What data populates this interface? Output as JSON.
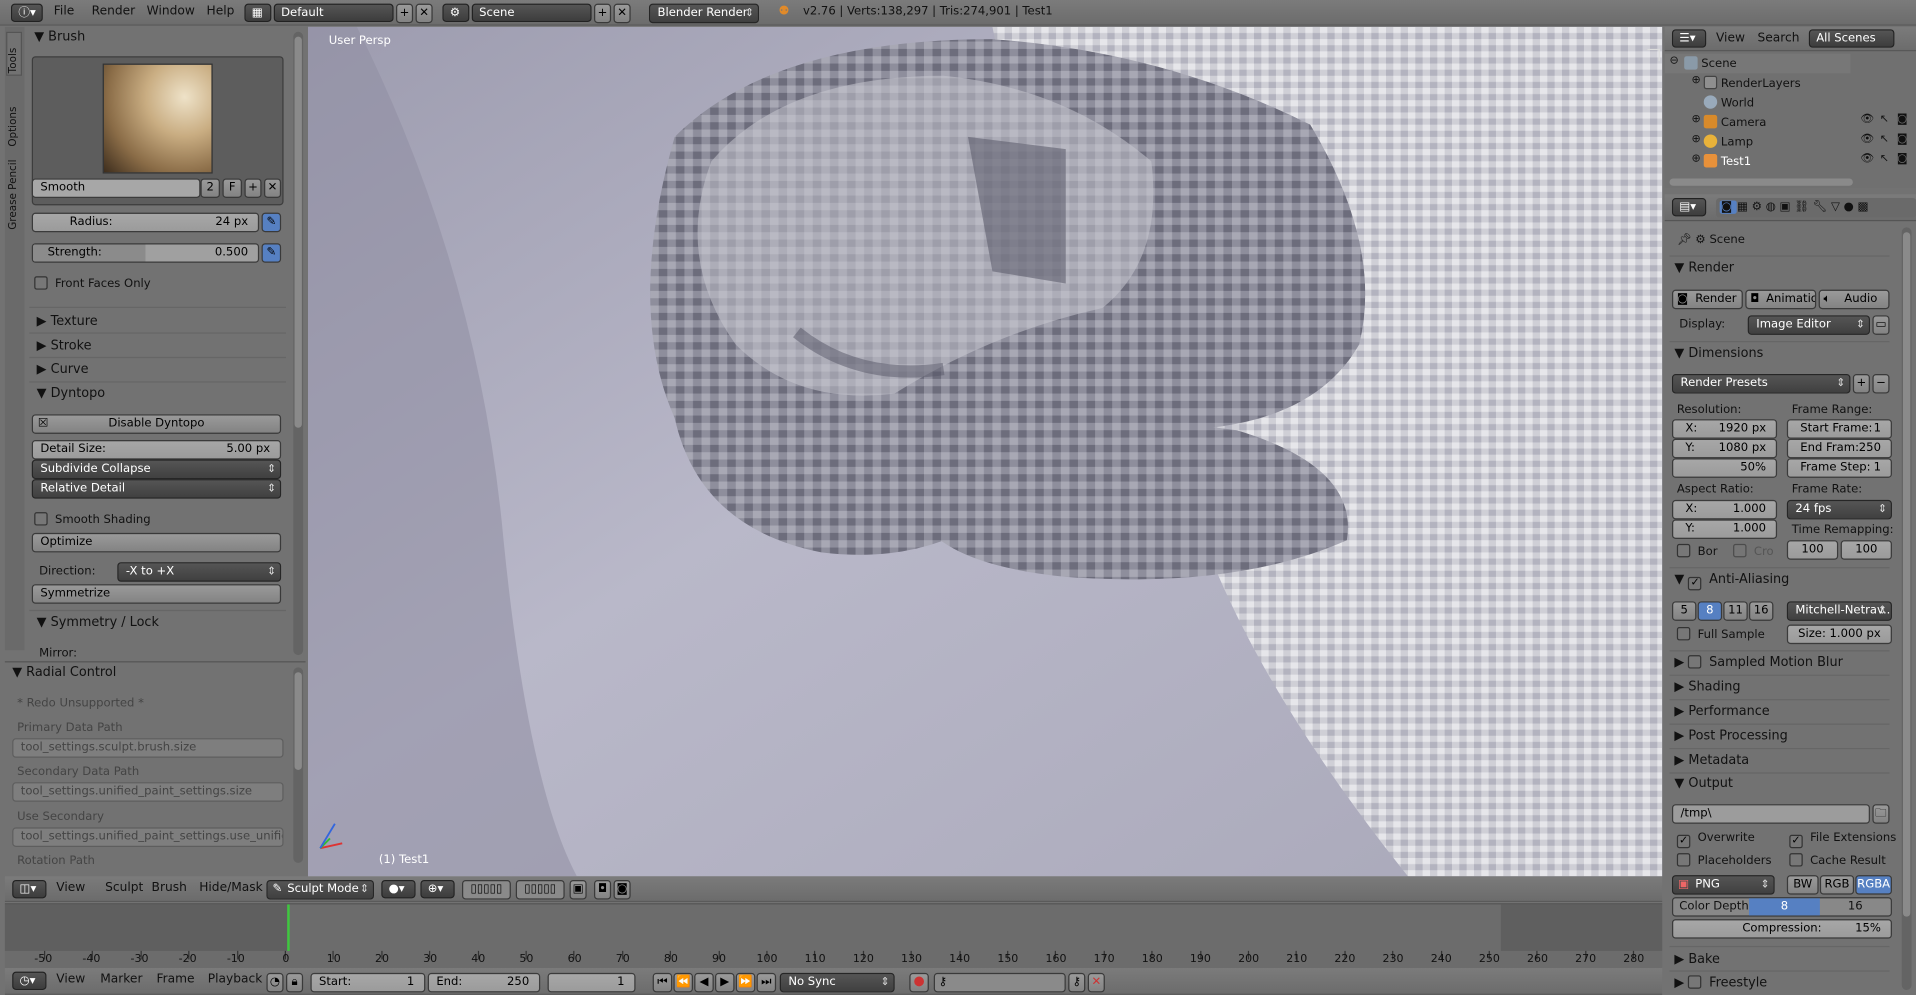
{
  "topbar": {
    "menus": [
      "File",
      "Render",
      "Window",
      "Help"
    ],
    "layout": "Default",
    "scene": "Scene",
    "engine": "Blender Render",
    "stats": "v2.76 | Verts:138,297 | Tris:274,901 | Test1"
  },
  "toolshelf": {
    "tabs": [
      "Tools",
      "Options",
      "Grease Pencil"
    ],
    "brush_header": "Brush",
    "brush_name": "Smooth",
    "brush_users": "2",
    "fake_user": "F",
    "radius_label": "Radius:",
    "radius_value": "24 px",
    "strength_label": "Strength:",
    "strength_value": "0.500",
    "strength_fill": 0.5,
    "front_faces": "Front Faces Only",
    "panels": [
      "Texture",
      "Stroke",
      "Curve"
    ],
    "dyntopo_header": "Dyntopo",
    "disable_dyntopo": "Disable Dyntopo",
    "detail_size_label": "Detail Size:",
    "detail_size_value": "5.00 px",
    "subdivide": "Subdivide Collapse",
    "relative": "Relative Detail",
    "smooth_shading": "Smooth Shading",
    "optimize": "Optimize",
    "direction_label": "Direction:",
    "direction_value": "-X to +X",
    "symmetrize": "Symmetrize",
    "symmetry_header": "Symmetry / Lock",
    "mirror_label": "Mirror:"
  },
  "redo": {
    "header": "Radial Control",
    "unsupported": "* Redo Unsupported *",
    "primary_label": "Primary Data Path",
    "primary_value": "tool_settings.sculpt.brush.size",
    "secondary_label": "Secondary Data Path",
    "secondary_value": "tool_settings.unified_paint_settings.size",
    "use_secondary_label": "Use Secondary",
    "use_secondary_value": "tool_settings.unified_paint_settings.use_unified_size",
    "rotation_label": "Rotation Path"
  },
  "viewport": {
    "view_name": "User Persp",
    "object_label": "(1) Test1"
  },
  "viewport_header": {
    "menus": [
      "View",
      "Sculpt",
      "Brush",
      "Hide/Mask"
    ],
    "mode": "Sculpt Mode"
  },
  "outliner": {
    "menus": [
      "View",
      "Search"
    ],
    "filter": "All Scenes",
    "items": [
      {
        "name": "Scene",
        "indent": 0
      },
      {
        "name": "RenderLayers",
        "indent": 1
      },
      {
        "name": "World",
        "indent": 1
      },
      {
        "name": "Camera",
        "indent": 1
      },
      {
        "name": "Lamp",
        "indent": 1
      },
      {
        "name": "Test1",
        "indent": 1
      }
    ]
  },
  "properties": {
    "context": "Scene",
    "render_header": "Render",
    "render_btn": "Render",
    "animation_btn": "Animation",
    "audio_btn": "Audio",
    "display_label": "Display:",
    "display_value": "Image Editor",
    "dimensions_header": "Dimensions",
    "presets": "Render Presets",
    "resolution_label": "Resolution:",
    "res_x": "X:",
    "res_x_value": "1920 px",
    "res_y": "Y:",
    "res_y_value": "1080 px",
    "res_pct": "50%",
    "frame_range_label": "Frame Range:",
    "start_frame": "Start Frame:",
    "start_frame_value": "1",
    "end_frame": "End Fram:",
    "end_frame_value": "250",
    "frame_step": "Frame Step:",
    "frame_step_value": "1",
    "aspect_label": "Aspect Ratio:",
    "asp_x": "X:",
    "asp_x_value": "1.000",
    "asp_y": "Y:",
    "asp_y_value": "1.000",
    "frame_rate_label": "Frame Rate:",
    "frame_rate_value": "24 fps",
    "time_remap_label": "Time Remapping:",
    "remap_old": "100",
    "remap_new": "100",
    "border": "Bor",
    "crop": "Cro",
    "aa_header": "Anti-Aliasing",
    "aa_samples": [
      "5",
      "8",
      "11",
      "16"
    ],
    "aa_filter": "Mitchell-Netrav...",
    "full_sample": "Full Sample",
    "aa_size": "Size: 1.000 px",
    "motion_blur": "Sampled Motion Blur",
    "collapsed": [
      "Shading",
      "Performance",
      "Post Processing",
      "Metadata"
    ],
    "output_header": "Output",
    "output_path": "/tmp\\",
    "overwrite": "Overwrite",
    "file_ext": "File Extensions",
    "placeholders": "Placeholders",
    "cache": "Cache Result",
    "format": "PNG",
    "bw": "BW",
    "rgb": "RGB",
    "rgba": "RGBA",
    "color_depth_label": "Color Depth:",
    "depth_8": "8",
    "depth_16": "16",
    "compression": "Compression:",
    "compression_value": "15%",
    "bake": "Bake",
    "freestyle": "Freestyle"
  },
  "timeline": {
    "ticks": [
      "-50",
      "-40",
      "-30",
      "-20",
      "-10",
      "0",
      "10",
      "20",
      "30",
      "40",
      "50",
      "60",
      "70",
      "80",
      "90",
      "100",
      "110",
      "120",
      "130",
      "140",
      "150",
      "160",
      "170",
      "180",
      "190",
      "200",
      "210",
      "220",
      "230",
      "240",
      "250",
      "260",
      "270",
      "280"
    ],
    "menus": [
      "View",
      "Marker",
      "Frame",
      "Playback"
    ],
    "start_label": "Start:",
    "start_value": "1",
    "end_label": "End:",
    "end_value": "250",
    "current": "1",
    "sync": "No Sync"
  },
  "colors": {
    "accent": "#5680c2",
    "header": "#727272",
    "panel": "#727272",
    "viewport": "#b8b7c6",
    "timeline": "#6c6c6c"
  }
}
